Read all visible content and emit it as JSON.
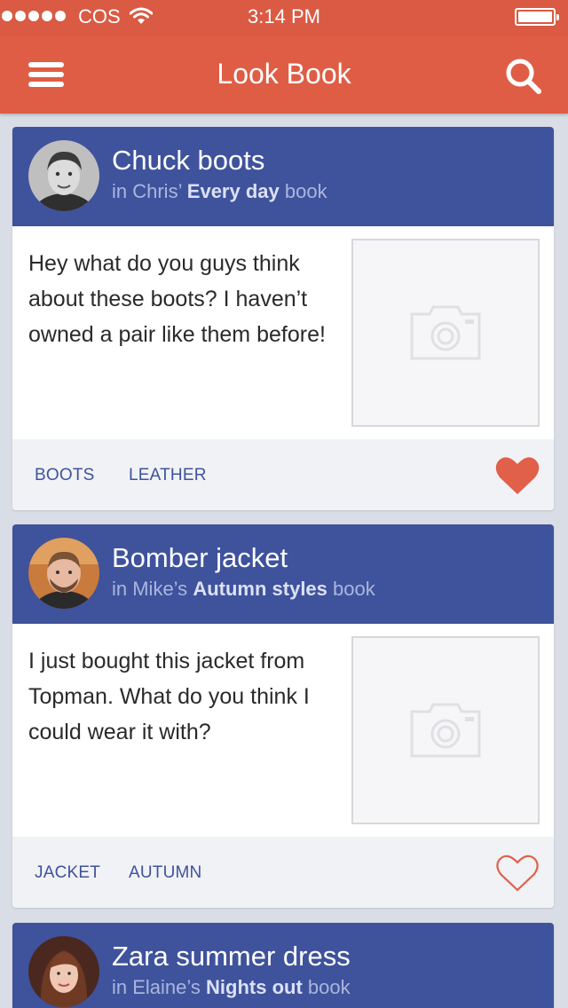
{
  "status_bar": {
    "carrier": "COS",
    "time": "3:14 PM"
  },
  "header": {
    "title": "Look Book",
    "menu_icon": "hamburger-menu-icon",
    "search_icon": "search-icon"
  },
  "colors": {
    "accent": "#df5d45",
    "card_header": "#3f529c",
    "tag_text": "#3f529c",
    "heart": "#e0604a"
  },
  "posts": [
    {
      "title": "Chuck boots",
      "subtitle_prefix": "in Chris’",
      "book_name": "Every day",
      "subtitle_suffix": "book",
      "body": "Hey what do you guys think about these boots? I haven’t owned a pair like them before!",
      "tags": [
        "BOOTS",
        "LEATHER"
      ],
      "liked": true,
      "photo_icon": "camera-placeholder-icon"
    },
    {
      "title": "Bomber jacket",
      "subtitle_prefix": "in Mike’s",
      "book_name": "Autumn styles",
      "subtitle_suffix": "book",
      "body": "I just bought this jacket from Topman. What do you think I could wear it with?",
      "tags": [
        "JACKET",
        "AUTUMN"
      ],
      "liked": false,
      "photo_icon": "camera-placeholder-icon"
    },
    {
      "title": "Zara summer dress",
      "subtitle_prefix": "in Elaine’s",
      "book_name": "Nights out",
      "subtitle_suffix": "book"
    }
  ]
}
